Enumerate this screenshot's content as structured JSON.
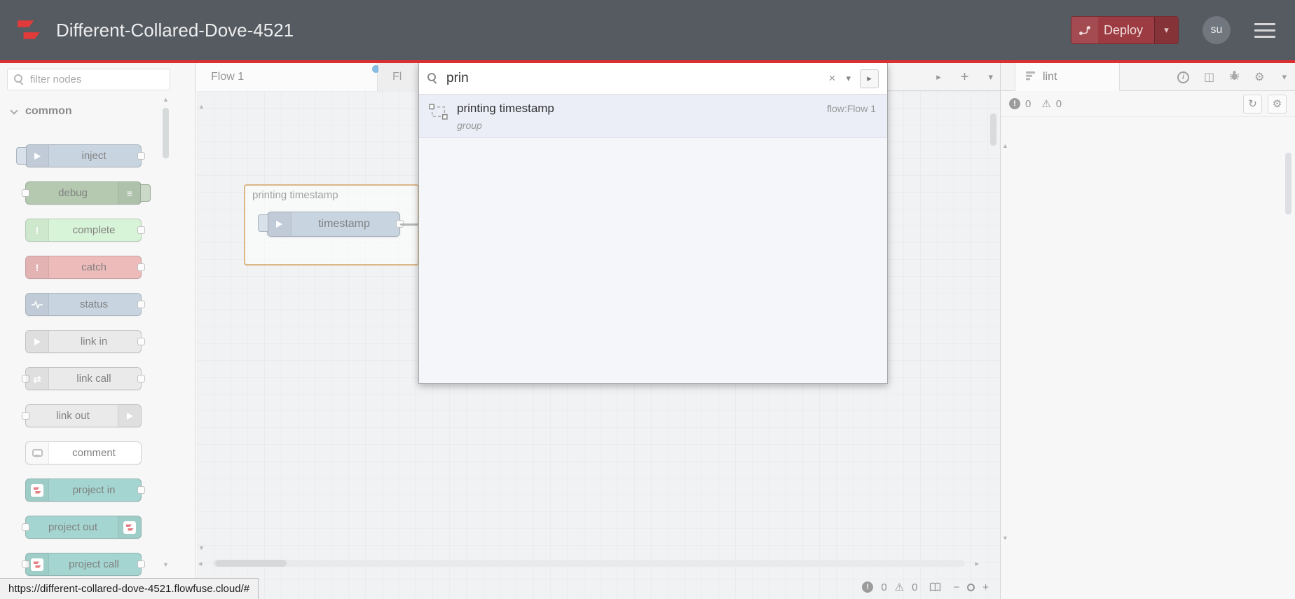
{
  "colors": {
    "accent_red": "#dc3030",
    "brand_red": "#e03a3a",
    "deploy_bg": "#9c3c42",
    "header_bg": "#565b62",
    "tab_dot_blue": "#3d94d2",
    "group_border": "#c68c3f",
    "inject_node": "#a6bbcf"
  },
  "icons": {
    "clear": "×",
    "caret_down": "▾",
    "caret_right": "▸",
    "plus": "+",
    "minus": "−",
    "up_arrow": "▲",
    "down_arrow": "▼",
    "left_arrow": "◂",
    "right_arrow": "▸",
    "warning": "⚠",
    "gear": "⚙",
    "refresh": "↻",
    "exclaim": "!",
    "menu_list": "≡",
    "swap_arrows": "⇄",
    "book": "◫",
    "info": "i"
  },
  "header": {
    "title": "Different-Collared-Dove-4521",
    "deploy_label": "Deploy",
    "avatar_text": "su"
  },
  "palette": {
    "filter_placeholder": "filter nodes",
    "category_label": "common",
    "nodes": [
      {
        "label": "inject",
        "color": "#a6bbcf"
      },
      {
        "label": "debug",
        "color": "#87a980"
      },
      {
        "label": "complete",
        "color": "#c0edc0"
      },
      {
        "label": "catch",
        "color": "#e49191"
      },
      {
        "label": "status",
        "color": "#a6bbcf"
      },
      {
        "label": "link in",
        "color": "#dddddd"
      },
      {
        "label": "link call",
        "color": "#dddddd"
      },
      {
        "label": "link out",
        "color": "#dddddd"
      },
      {
        "label": "comment",
        "color": "#ffffff"
      },
      {
        "label": "project in",
        "color": "#6cbcb4"
      },
      {
        "label": "project out",
        "color": "#6cbcb4"
      },
      {
        "label": "project call",
        "color": "#6cbcb4"
      }
    ]
  },
  "tabbar": {
    "tab1": "Flow 1",
    "tab2_partial": "Fl"
  },
  "canvas": {
    "group_label": "printing timestamp",
    "node_label": "timestamp",
    "error_count": "0",
    "warning_count": "0"
  },
  "search": {
    "query": "prin",
    "result_title": "printing timestamp",
    "result_type": "group",
    "result_flow": "flow:Flow 1"
  },
  "sidebar": {
    "tab_label": "lint",
    "error_count": "0",
    "warning_count": "0"
  },
  "statusbar": {
    "url": "https://different-collared-dove-4521.flowfuse.cloud/#"
  }
}
